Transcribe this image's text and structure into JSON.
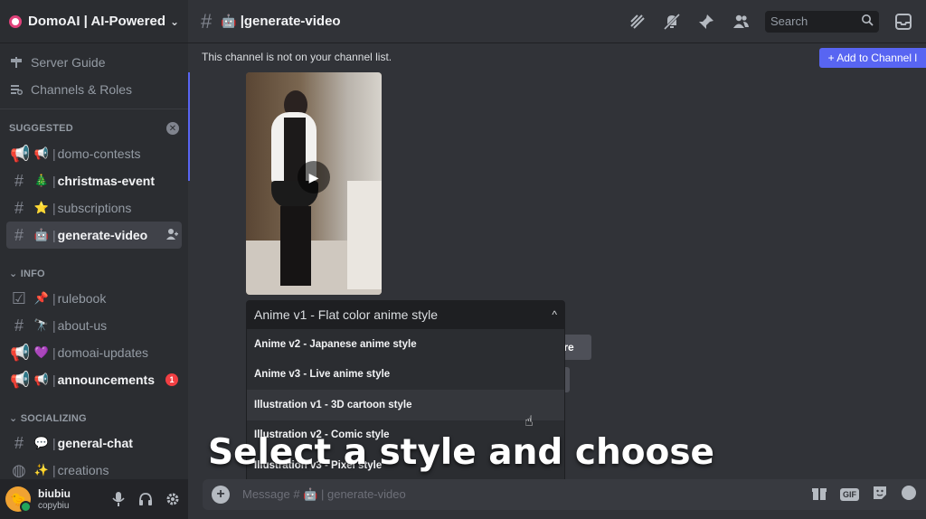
{
  "server": {
    "name": "DomoAI | AI-Powered A"
  },
  "nav_top": [
    {
      "label": "Server Guide",
      "icon": "signpost-icon"
    },
    {
      "label": "Channels & Roles",
      "icon": "channels-roles-icon"
    }
  ],
  "categories": {
    "suggested": "SUGGESTED",
    "info": "INFO",
    "socializing": "SOCIALIZING"
  },
  "channels_suggested": [
    {
      "name": "domo-contests",
      "emoji": "📢",
      "bold": false
    },
    {
      "name": "christmas-event",
      "emoji": "🎄",
      "bold": true
    },
    {
      "name": "subscriptions",
      "emoji": "⭐",
      "bold": false
    },
    {
      "name": "generate-video",
      "emoji": "🤖",
      "bold": true
    }
  ],
  "channels_info": [
    {
      "name": "rulebook",
      "emoji": "📌",
      "bold": false
    },
    {
      "name": "about-us",
      "emoji": "🔭",
      "bold": false
    },
    {
      "name": "domoai-updates",
      "emoji": "💜",
      "bold": false
    },
    {
      "name": "announcements",
      "emoji": "📢",
      "bold": true,
      "badge": "1"
    }
  ],
  "channels_social": [
    {
      "name": "general-chat",
      "emoji": "💬",
      "bold": true
    },
    {
      "name": "creations",
      "emoji": "✨",
      "bold": false
    }
  ],
  "user": {
    "name": "biubiu",
    "tag": "copybiu"
  },
  "topbar": {
    "channel": "generate-video",
    "search_placeholder": "Search"
  },
  "notice": {
    "text": "This channel is not on your channel list.",
    "add_button": "+ Add to Channel l"
  },
  "select": {
    "selected": "Anime v1 - Flat color anime style",
    "options": [
      "Anime v2 - Japanese anime style",
      "Anime v3 - Live anime style",
      "Illustration v1 - 3D cartoon style",
      "Illustration v2 - Comic style",
      "Illustration v3 - Pixel style"
    ]
  },
  "partial_button": "ore",
  "message": {
    "placeholder": "Message # 🤖 | generate-video"
  },
  "caption": "Select a style and choose",
  "colors": {
    "accent": "#5865f2",
    "sidebar_bg": "#2b2d31",
    "chat_bg": "#313338"
  }
}
